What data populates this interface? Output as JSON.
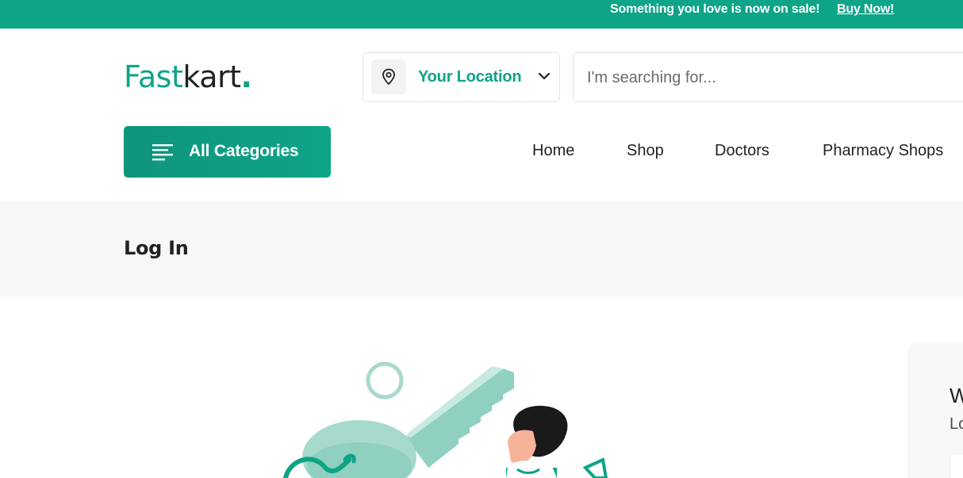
{
  "top_bar": {
    "promo_text": "Something you love is now on sale!",
    "promo_link": "Buy Now!",
    "background_color": "#0da487"
  },
  "header": {
    "logo": {
      "part_a": "Fast",
      "part_b": "kart",
      "dot": "."
    },
    "location": {
      "icon": "map-pin-icon",
      "label": "Your Location",
      "dropdown_icon": "chevron-down-icon"
    },
    "search": {
      "placeholder": "I'm searching for...",
      "value": ""
    }
  },
  "category_button": {
    "icon": "menu-lines-icon",
    "label": "All Categories"
  },
  "nav": {
    "items": [
      {
        "label": "Home"
      },
      {
        "label": "Shop"
      },
      {
        "label": "Doctors"
      },
      {
        "label": "Pharmacy Shops"
      }
    ]
  },
  "breadcrumb": {
    "title": "Log In"
  },
  "side_card": {
    "heading": "W",
    "subtext": "Lo"
  },
  "colors": {
    "accent": "#0da487",
    "accent_light": "#a7d9cd",
    "panel_bg": "#f7f7f7"
  }
}
